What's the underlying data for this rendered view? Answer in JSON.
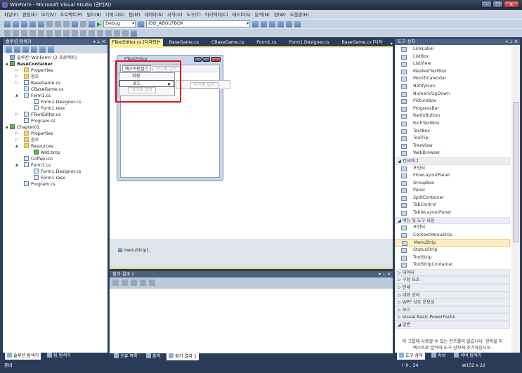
{
  "window": {
    "title": "WinForm - Microsoft Visual Studio (관리자)"
  },
  "menu": [
    "파일(F)",
    "편집(E)",
    "보기(V)",
    "프로젝트(P)",
    "빌드(B)",
    "디버그(D)",
    "팀(M)",
    "데이터(A)",
    "서식(O)",
    "도구(T)",
    "아키텍처(C)",
    "테스트(S)",
    "분석(N)",
    "창(W)",
    "도움말(H)"
  ],
  "toolbar": {
    "config": "Debug",
    "target": "IDD_ABOUTBOX"
  },
  "solution_explorer": {
    "title": "솔루션 탐색기",
    "items": [
      {
        "t": "솔루션 'WinForm' (2 프로젝트)",
        "d": 0,
        "ic": "sln"
      },
      {
        "t": "BaseContainer",
        "d": 0,
        "ic": "pj",
        "a": "▲",
        "b": true
      },
      {
        "t": "Properties",
        "d": 1,
        "ic": "fd",
        "a": "▷"
      },
      {
        "t": "참조",
        "d": 1,
        "ic": "fd",
        "a": "▷"
      },
      {
        "t": "BaseGame.cs",
        "d": 1,
        "ic": "cs",
        "a": "▷"
      },
      {
        "t": "CBaseGame.cs",
        "d": 1,
        "ic": "cs"
      },
      {
        "t": "Form1.cs",
        "d": 1,
        "ic": "cs",
        "a": "▲"
      },
      {
        "t": "Form1.Designer.cs",
        "d": 2,
        "ic": "cs"
      },
      {
        "t": "Form1.resx",
        "d": 2,
        "ic": "cs"
      },
      {
        "t": "FTextEditor.cs",
        "d": 1,
        "ic": "cs",
        "a": "▷"
      },
      {
        "t": "Program.cs",
        "d": 1,
        "ic": "cs"
      },
      {
        "t": "Chapter02",
        "d": 0,
        "ic": "pj",
        "a": "▲"
      },
      {
        "t": "Properties",
        "d": 1,
        "ic": "fd",
        "a": "▷"
      },
      {
        "t": "참조",
        "d": 1,
        "ic": "fd",
        "a": "▷"
      },
      {
        "t": "Resources",
        "d": 1,
        "ic": "fd",
        "a": "▲"
      },
      {
        "t": "Add.bmp",
        "d": 2,
        "ic": "pj"
      },
      {
        "t": "Coffee.ico",
        "d": 1,
        "ic": "cs"
      },
      {
        "t": "Form1.cs",
        "d": 1,
        "ic": "cs",
        "a": "▲"
      },
      {
        "t": "Form1.Designer.cs",
        "d": 2,
        "ic": "cs"
      },
      {
        "t": "Form1.resx",
        "d": 2,
        "ic": "cs"
      },
      {
        "t": "Program.cs",
        "d": 1,
        "ic": "cs"
      }
    ]
  },
  "doc_tabs": [
    "FTextEditor.cs [디자인]*",
    "BaseGame.cs",
    "CBaseGame.cs",
    "Form1.cs",
    "Form1.Designer.cs",
    "BaseGame.cs [디자인]"
  ],
  "form": {
    "title": "FTextEditor",
    "menu_top": "텍스트편집기",
    "placeholder": "여기에 입력",
    "items": [
      "저장",
      "로드"
    ]
  },
  "tray": {
    "component": "menuStrip1"
  },
  "find": {
    "title": "찾기 결과 1"
  },
  "left_tabs": [
    "솔루션 탐색기",
    "팀 탐색기"
  ],
  "bottom_tabs": [
    "오류 목록",
    "출력",
    "찾기 결과 1"
  ],
  "toolbox": {
    "title": "도구 상자",
    "entries": [
      {
        "t": "LinkLabel"
      },
      {
        "t": "ListBox"
      },
      {
        "t": "ListView"
      },
      {
        "t": "MaskedTextBox"
      },
      {
        "t": "MonthCalendar"
      },
      {
        "t": "NotifyIcon"
      },
      {
        "t": "NumericUpDown"
      },
      {
        "t": "PictureBox"
      },
      {
        "t": "ProgressBar"
      },
      {
        "t": "RadioButton"
      },
      {
        "t": "RichTextBox"
      },
      {
        "t": "TextBox"
      },
      {
        "t": "ToolTip"
      },
      {
        "t": "TreeView"
      },
      {
        "t": "WebBrowser"
      },
      {
        "t": "컨테이너",
        "g": "◢"
      },
      {
        "t": "포인터"
      },
      {
        "t": "FlowLayoutPanel"
      },
      {
        "t": "GroupBox"
      },
      {
        "t": "Panel"
      },
      {
        "t": "SplitContainer"
      },
      {
        "t": "TabControl"
      },
      {
        "t": "TableLayoutPanel"
      },
      {
        "t": "메뉴 및 도구 모음",
        "g": "◢"
      },
      {
        "t": "포인터"
      },
      {
        "t": "ContextMenuStrip"
      },
      {
        "t": "MenuStrip",
        "sel": true
      },
      {
        "t": "StatusStrip"
      },
      {
        "t": "ToolStrip"
      },
      {
        "t": "ToolStripContainer"
      },
      {
        "t": "데이터",
        "g": "▷"
      },
      {
        "t": "구성 요소",
        "g": "▷"
      },
      {
        "t": "인쇄",
        "g": "▷"
      },
      {
        "t": "대화 상자",
        "g": "▷"
      },
      {
        "t": "WPF 상호 운용성",
        "g": "▷"
      },
      {
        "t": "보고",
        "g": "▷"
      },
      {
        "t": "Visual Basic PowerPacks",
        "g": "▷"
      },
      {
        "t": "일반",
        "g": "◢"
      }
    ],
    "empty_msg": "이 그룹에 사용할 수 있는 컨트롤이 없습니다. 항목을 이 텍스트로 끌어와 도구 상자에 추가하십시오."
  },
  "right_tabs": [
    "도구 상자",
    "속성",
    "서버 탐색기"
  ],
  "status": {
    "text": "준비",
    "position": "0 , 24",
    "size": "152 x 22"
  },
  "colors": {
    "frame": "#2b3c59",
    "highlight": "#e8101a",
    "active_tab": "#fbee9f"
  }
}
